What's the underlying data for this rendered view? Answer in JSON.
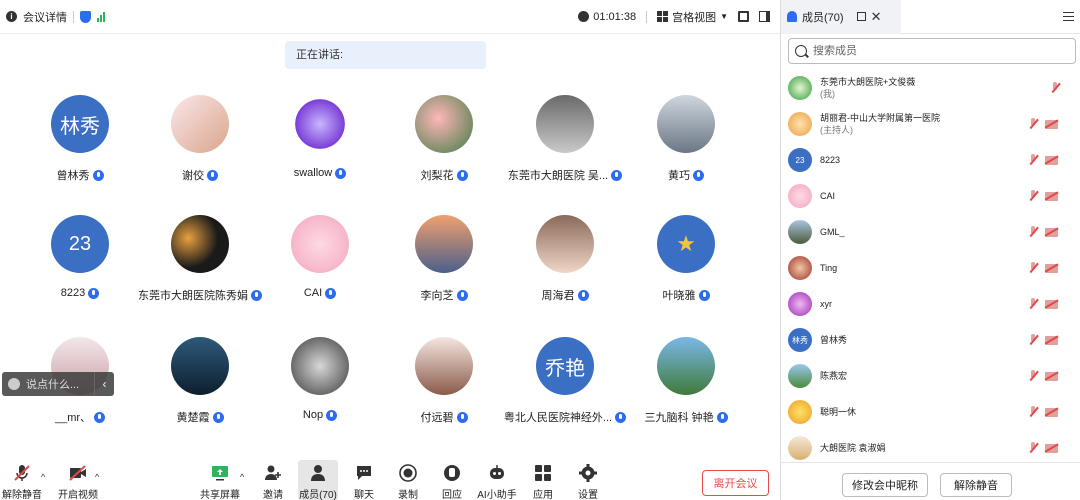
{
  "topbar": {
    "meeting_info_label": "会议详情",
    "timer": "01:01:38",
    "view_label": "宫格视图"
  },
  "speaking_label": "正在讲话:",
  "tiles": [
    {
      "name": "曾林秀",
      "avatar_text": "林秀"
    },
    {
      "name": "谢佼",
      "avatar_text": ""
    },
    {
      "name": "swallow",
      "avatar_text": ""
    },
    {
      "name": "刘梨花",
      "avatar_text": ""
    },
    {
      "name": "东莞市大朗医院 吴...",
      "avatar_text": ""
    },
    {
      "name": "黄巧",
      "avatar_text": ""
    },
    {
      "name": "8223",
      "avatar_text": "23"
    },
    {
      "name": "东莞市大朗医院陈秀娟",
      "avatar_text": ""
    },
    {
      "name": "CAI",
      "avatar_text": ""
    },
    {
      "name": "李向芝",
      "avatar_text": ""
    },
    {
      "name": "周海君",
      "avatar_text": ""
    },
    {
      "name": "叶晓雅",
      "avatar_text": ""
    },
    {
      "name": "__mr、",
      "avatar_text": ""
    },
    {
      "name": "黄楚霞",
      "avatar_text": ""
    },
    {
      "name": "Nop",
      "avatar_text": ""
    },
    {
      "name": "付远碧",
      "avatar_text": ""
    },
    {
      "name": "粤北人民医院神经外...",
      "avatar_text": "乔艳"
    },
    {
      "name": "三九脑科 钟艳",
      "avatar_text": ""
    }
  ],
  "chat_hint": "说点什么...",
  "toolbar": {
    "unmute": "解除静音",
    "start_video": "开启视频",
    "share_screen": "共享屏幕",
    "invite": "邀请",
    "members": "成员(70)",
    "chat": "聊天",
    "record": "录制",
    "react": "回应",
    "ai_assistant": "AI小助手",
    "apps": "应用",
    "settings": "设置",
    "leave": "离开会议"
  },
  "panel": {
    "tab_title": "成员(70)",
    "search_placeholder": "搜索成员",
    "members": [
      {
        "name": "东莞市大朗医院+文俊薇",
        "role": "(我)",
        "avatar_text": ""
      },
      {
        "name": "胡丽君-中山大学附属第一医院",
        "role": "(主持人)",
        "avatar_text": ""
      },
      {
        "name": "8223",
        "role": "",
        "avatar_text": "23"
      },
      {
        "name": "CAI",
        "role": "",
        "avatar_text": ""
      },
      {
        "name": "GML_",
        "role": "",
        "avatar_text": ""
      },
      {
        "name": "Ting",
        "role": "",
        "avatar_text": ""
      },
      {
        "name": "xyr",
        "role": "",
        "avatar_text": ""
      },
      {
        "name": "曾林秀",
        "role": "",
        "avatar_text": "林秀"
      },
      {
        "name": "陈燕宏",
        "role": "",
        "avatar_text": ""
      },
      {
        "name": "聪明一休",
        "role": "",
        "avatar_text": ""
      },
      {
        "name": "大朗医院 袁淑娟",
        "role": "",
        "avatar_text": ""
      }
    ],
    "rename_button": "修改会中昵称",
    "unmute_all_button": "解除静音"
  },
  "colors": {
    "accent": "#2d6cf0",
    "avatar_blue": "#3b6fc4",
    "leave_red": "#e64b4b"
  }
}
